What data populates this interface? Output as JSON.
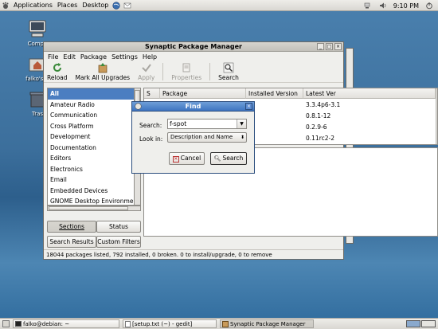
{
  "top_panel": {
    "menus": [
      "Applications",
      "Places",
      "Desktop"
    ],
    "clock": "9:10 PM"
  },
  "desktop_icons": [
    {
      "label": "Compu",
      "icon": "computer-icon"
    },
    {
      "label": "falko's H",
      "icon": "home-folder-icon"
    },
    {
      "label": "Tras",
      "icon": "trash-icon"
    }
  ],
  "window": {
    "title": "Synaptic Package Manager",
    "menu": [
      "File",
      "Edit",
      "Package",
      "Settings",
      "Help"
    ],
    "toolbar": {
      "reload": "Reload",
      "mark_all": "Mark All Upgrades",
      "apply": "Apply",
      "properties": "Properties",
      "search": "Search"
    },
    "sections": [
      "All",
      "Amateur Radio",
      "Communication",
      "Cross Platform",
      "Development",
      "Documentation",
      "Editors",
      "Electronics",
      "Email",
      "Embedded Devices",
      "GNOME Desktop Environment"
    ],
    "filter_buttons": {
      "sections": "Sections",
      "status": "Status",
      "search_results": "Search Results",
      "custom_filters": "Custom Filters"
    },
    "table": {
      "columns": [
        "S",
        "Package",
        "Installed Version",
        "Latest Ver"
      ],
      "latest_versions": [
        "3.3.4p6-3.1",
        "0.8.1-12",
        "0.2.9-6",
        "0.11rc2-2"
      ]
    },
    "status": "18044 packages listed, 792 installed, 0 broken. 0 to install/upgrade, 0 to remove"
  },
  "find_dialog": {
    "title": "Find",
    "search_label": "Search:",
    "search_value": "f-spot",
    "lookin_label": "Look in:",
    "lookin_value": "Description and Name",
    "cancel": "Cancel",
    "search_button": "Search"
  },
  "taskbar": {
    "items": [
      "falko@debian: ~",
      "[setup.txt (~) - gedit]",
      "Synaptic Package Manager"
    ]
  }
}
